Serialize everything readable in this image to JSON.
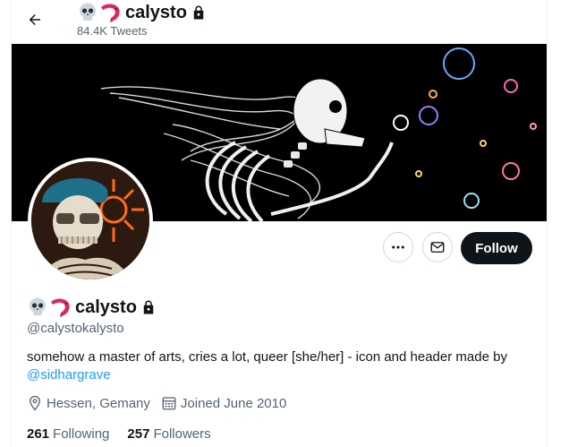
{
  "header": {
    "title": "calysto",
    "tweet_count": "84.4K Tweets"
  },
  "profile": {
    "display_name": "calysto",
    "handle": "@calystokalysto",
    "bio_text": "somehow a master of arts, cries a lot, queer [she/her] - icon and header made by ",
    "bio_mention": "@sidhargrave",
    "location": "Hessen, Gemany",
    "joined": "Joined June 2010",
    "following_count": "261",
    "following_label": "Following",
    "followers_count": "257",
    "followers_label": "Followers"
  },
  "actions": {
    "more_icon": "more-icon",
    "message_icon": "mail-icon",
    "follow_label": "Follow"
  },
  "colors": {
    "accent": "#1d9bf0",
    "text": "#0f1419",
    "muted": "#536471",
    "follow_bg": "#0f1419"
  }
}
